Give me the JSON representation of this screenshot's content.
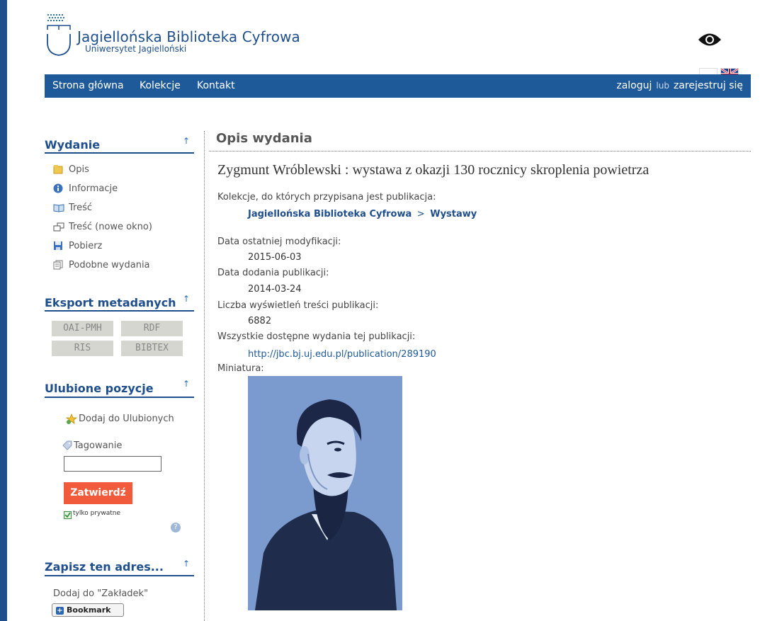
{
  "header": {
    "title": "Jagiellońska Biblioteka Cyfrowa",
    "subtitle": "Uniwersytet Jagielloński"
  },
  "nav": {
    "items": [
      "Strona główna",
      "Kolekcje",
      "Kontakt"
    ],
    "login": "zaloguj",
    "or": "lub",
    "register": "zarejestruj się"
  },
  "sidebar": {
    "edition": {
      "heading": "Wydanie",
      "items": [
        {
          "label": "Opis",
          "icon": "description-icon"
        },
        {
          "label": "Informacje",
          "icon": "info-icon"
        },
        {
          "label": "Treść",
          "icon": "book-icon"
        },
        {
          "label": "Treść (nowe okno)",
          "icon": "new-window-icon"
        },
        {
          "label": "Pobierz",
          "icon": "save-icon"
        },
        {
          "label": "Podobne wydania",
          "icon": "similar-icon"
        }
      ]
    },
    "export": {
      "heading": "Eksport metadanych",
      "buttons": [
        "OAI-PMH",
        "RDF",
        "RIS",
        "BIBTEX"
      ]
    },
    "favorites": {
      "heading": "Ulubione pozycje",
      "add": "Dodaj do Ulubionych",
      "tagging": "Tagowanie",
      "submit": "Zatwierdź",
      "private": "tylko prywatne"
    },
    "bookmark": {
      "heading": "Zapisz ten adres...",
      "text": "Dodaj do \"Zakładek\"",
      "button": "Bookmark"
    }
  },
  "main": {
    "heading": "Opis wydania",
    "title": "Zygmunt Wróblewski : wystawa z okazji 130 rocznicy skroplenia powietrza",
    "collections_label": "Kolekcje, do których przypisana jest publikacja:",
    "collection_root": "Jagiellońska Biblioteka Cyfrowa",
    "collection_sep": ">",
    "collection_leaf": "Wystawy",
    "modified_label": "Data ostatniej modyfikacji:",
    "modified_value": "2015-06-03",
    "added_label": "Data dodania publikacji:",
    "added_value": "2014-03-24",
    "views_label": "Liczba wyświetleń treści publikacji:",
    "views_value": "6882",
    "editions_label": "Wszystkie dostępne wydania tej publikacji:",
    "editions_link": "http://jbc.bj.uj.edu.pl/publication/289190",
    "thumb_label": "Miniatura:"
  },
  "colors": {
    "nav_bg": "#1e5a99",
    "heading": "#1e4f8c",
    "submit_bg": "#f15a3a"
  }
}
